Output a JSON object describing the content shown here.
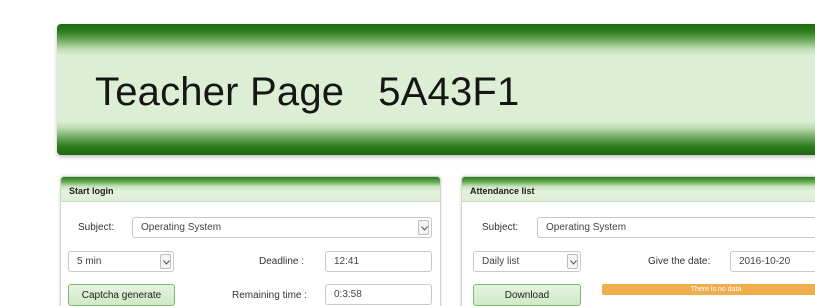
{
  "header": {
    "title": "Teacher Page",
    "code": "5A43F1"
  },
  "start_login": {
    "title": "Start login",
    "subject_label": "Subject:",
    "subject_value": "Operating System",
    "duration_value": "5 min",
    "deadline_label": "Deadline :",
    "deadline_value": "12:41",
    "captcha_button": "Captcha generate",
    "remaining_label": "Remaining time :",
    "remaining_value": "0:3:58"
  },
  "attendance": {
    "title": "Attendance list",
    "subject_label": "Subject:",
    "subject_value": "Operating System",
    "list_type_value": "Daily list",
    "date_label": "Give the date:",
    "date_value": "2016-10-20",
    "download_button": "Download",
    "no_data_text": "There is no data"
  },
  "colors": {
    "header_green": "#2d7f1e",
    "panel_background": "#dcefd4",
    "warning_bar": "#f0ad4e"
  }
}
